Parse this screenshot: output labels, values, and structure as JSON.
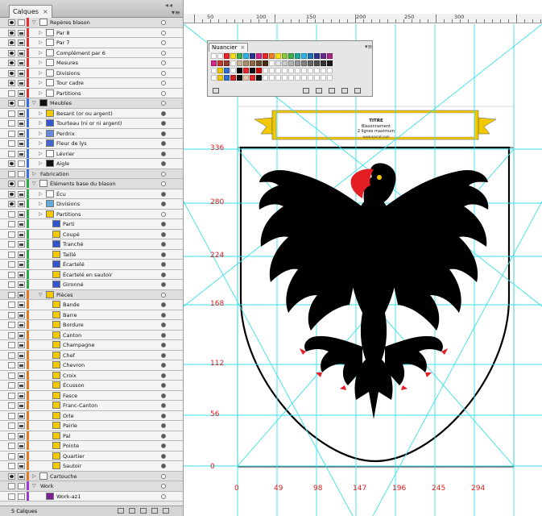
{
  "layers_panel": {
    "tab_label": "Calques",
    "close_glyph": "×",
    "grip": "◂◂",
    "menu_glyph": "▾≡",
    "footer_count": "5 Calques",
    "rows": [
      {
        "label": "Repères blason",
        "type": "layer",
        "depth": 0,
        "eye": true,
        "lock": false,
        "color": "#e03030",
        "expanded": true,
        "thumb": "#ffffff",
        "target": "hollow"
      },
      {
        "label": "Par 8",
        "type": "item",
        "depth": 1,
        "eye": true,
        "lock": true,
        "color": "#e03030",
        "thumb": "#ffffff",
        "target": "hollow"
      },
      {
        "label": "Par 7",
        "type": "item",
        "depth": 1,
        "eye": true,
        "lock": true,
        "color": "#e03030",
        "thumb": "#ffffff",
        "target": "hollow"
      },
      {
        "label": "Complément par 6",
        "type": "item",
        "depth": 1,
        "eye": true,
        "lock": true,
        "color": "#e03030",
        "thumb": "#ffffff",
        "target": "hollow"
      },
      {
        "label": "Mesures",
        "type": "item",
        "depth": 1,
        "eye": true,
        "lock": true,
        "color": "#e03030",
        "thumb": "#ffffff",
        "target": "hollow"
      },
      {
        "label": "Divisions",
        "type": "item",
        "depth": 1,
        "eye": true,
        "lock": true,
        "color": "#e03030",
        "thumb": "#ffffff",
        "target": "hollow"
      },
      {
        "label": "Tour cadre",
        "type": "item",
        "depth": 1,
        "eye": true,
        "lock": true,
        "color": "#e03030",
        "thumb": "#ffffff",
        "target": "hollow"
      },
      {
        "label": "Partitions",
        "type": "item",
        "depth": 1,
        "eye": false,
        "lock": true,
        "color": "#e03030",
        "thumb": "#ffffff",
        "target": "hollow"
      },
      {
        "label": "Meubles",
        "type": "layer",
        "depth": 0,
        "eye": true,
        "lock": false,
        "color": "#3a6ee0",
        "expanded": true,
        "thumb": "#111111",
        "target": "hollow"
      },
      {
        "label": "Besant (or ou argent)",
        "type": "item",
        "depth": 1,
        "eye": false,
        "lock": true,
        "color": "#3a6ee0",
        "thumb": "#f2c800",
        "target": "filled"
      },
      {
        "label": "Tourteau (ni or ni argent)",
        "type": "item",
        "depth": 1,
        "eye": false,
        "lock": true,
        "color": "#3a6ee0",
        "thumb": "#3355cc",
        "target": "filled"
      },
      {
        "label": "Perdrix",
        "type": "item",
        "depth": 1,
        "eye": false,
        "lock": true,
        "color": "#3a6ee0",
        "thumb": "#6688dd",
        "target": "filled"
      },
      {
        "label": "Fleur de lys",
        "type": "item",
        "depth": 1,
        "eye": false,
        "lock": true,
        "color": "#3a6ee0",
        "thumb": "#4466cc",
        "target": "filled"
      },
      {
        "label": "Lévrier",
        "type": "item",
        "depth": 1,
        "eye": false,
        "lock": true,
        "color": "#3a6ee0",
        "thumb": "#ffffff",
        "target": "filled"
      },
      {
        "label": "Aigle",
        "type": "item",
        "depth": 1,
        "eye": true,
        "lock": false,
        "color": "#3a6ee0",
        "thumb": "#111111",
        "target": "filled"
      },
      {
        "label": "Fabrication",
        "type": "layer",
        "depth": 0,
        "eye": false,
        "lock": false,
        "color": "#3a6ee0",
        "expanded": false,
        "thumb": "",
        "target": "hollow"
      },
      {
        "label": "Éléments base du blason",
        "type": "layer",
        "depth": 0,
        "eye": true,
        "lock": false,
        "color": "#2aa84a",
        "expanded": true,
        "thumb": "#ffffff",
        "target": "hollow"
      },
      {
        "label": "Écu",
        "type": "item",
        "depth": 1,
        "eye": true,
        "lock": true,
        "color": "#2aa84a",
        "thumb": "#ffffff",
        "target": "filled"
      },
      {
        "label": "Divisions",
        "type": "item",
        "depth": 1,
        "eye": true,
        "lock": true,
        "color": "#2aa84a",
        "thumb": "#66aadd",
        "target": "filled"
      },
      {
        "label": "Partitions",
        "type": "item",
        "depth": 1,
        "eye": false,
        "lock": true,
        "color": "#2aa84a",
        "thumb": "#f2c800",
        "target": "hollow"
      },
      {
        "label": "Parti",
        "type": "item",
        "depth": 2,
        "eye": false,
        "lock": true,
        "color": "#2aa84a",
        "thumb": "#3355cc",
        "target": "filled"
      },
      {
        "label": "Coupé",
        "type": "item",
        "depth": 2,
        "eye": false,
        "lock": true,
        "color": "#2aa84a",
        "thumb": "#f2c800",
        "target": "filled"
      },
      {
        "label": "Tranché",
        "type": "item",
        "depth": 2,
        "eye": false,
        "lock": true,
        "color": "#2aa84a",
        "thumb": "#3355cc",
        "target": "filled"
      },
      {
        "label": "Taillé",
        "type": "item",
        "depth": 2,
        "eye": false,
        "lock": true,
        "color": "#2aa84a",
        "thumb": "#f2c800",
        "target": "filled"
      },
      {
        "label": "Écartelé",
        "type": "item",
        "depth": 2,
        "eye": false,
        "lock": true,
        "color": "#2aa84a",
        "thumb": "#3355cc",
        "target": "filled"
      },
      {
        "label": "Écartelé en sautoir",
        "type": "item",
        "depth": 2,
        "eye": false,
        "lock": true,
        "color": "#2aa84a",
        "thumb": "#f2c800",
        "target": "filled"
      },
      {
        "label": "Gironné",
        "type": "item",
        "depth": 2,
        "eye": false,
        "lock": true,
        "color": "#2aa84a",
        "thumb": "#3355cc",
        "target": "filled"
      },
      {
        "label": "Pièces",
        "type": "layer",
        "depth": 1,
        "eye": false,
        "lock": true,
        "color": "#e07a20",
        "expanded": true,
        "thumb": "#f2c800",
        "target": "hollow"
      },
      {
        "label": "Bande",
        "type": "item",
        "depth": 2,
        "eye": false,
        "lock": true,
        "color": "#e07a20",
        "thumb": "#f2c800",
        "target": "filled"
      },
      {
        "label": "Barre",
        "type": "item",
        "depth": 2,
        "eye": false,
        "lock": true,
        "color": "#e07a20",
        "thumb": "#f2c800",
        "target": "filled"
      },
      {
        "label": "Bordure",
        "type": "item",
        "depth": 2,
        "eye": false,
        "lock": true,
        "color": "#e07a20",
        "thumb": "#f2c800",
        "target": "filled"
      },
      {
        "label": "Canton",
        "type": "item",
        "depth": 2,
        "eye": false,
        "lock": true,
        "color": "#e07a20",
        "thumb": "#f2c800",
        "target": "filled"
      },
      {
        "label": "Champagne",
        "type": "item",
        "depth": 2,
        "eye": false,
        "lock": true,
        "color": "#e07a20",
        "thumb": "#f2c800",
        "target": "filled"
      },
      {
        "label": "Chef",
        "type": "item",
        "depth": 2,
        "eye": false,
        "lock": true,
        "color": "#e07a20",
        "thumb": "#f2c800",
        "target": "filled"
      },
      {
        "label": "Chevron",
        "type": "item",
        "depth": 2,
        "eye": false,
        "lock": true,
        "color": "#e07a20",
        "thumb": "#f2c800",
        "target": "filled"
      },
      {
        "label": "Croix",
        "type": "item",
        "depth": 2,
        "eye": false,
        "lock": true,
        "color": "#e07a20",
        "thumb": "#f2c800",
        "target": "filled"
      },
      {
        "label": "Écusson",
        "type": "item",
        "depth": 2,
        "eye": false,
        "lock": true,
        "color": "#e07a20",
        "thumb": "#f2c800",
        "target": "filled"
      },
      {
        "label": "Fasce",
        "type": "item",
        "depth": 2,
        "eye": false,
        "lock": true,
        "color": "#e07a20",
        "thumb": "#f2c800",
        "target": "filled"
      },
      {
        "label": "Franc-Canton",
        "type": "item",
        "depth": 2,
        "eye": false,
        "lock": true,
        "color": "#e07a20",
        "thumb": "#f2c800",
        "target": "filled"
      },
      {
        "label": "Orle",
        "type": "item",
        "depth": 2,
        "eye": false,
        "lock": true,
        "color": "#e07a20",
        "thumb": "#f2c800",
        "target": "filled"
      },
      {
        "label": "Pairle",
        "type": "item",
        "depth": 2,
        "eye": false,
        "lock": true,
        "color": "#e07a20",
        "thumb": "#f2c800",
        "target": "filled"
      },
      {
        "label": "Pal",
        "type": "item",
        "depth": 2,
        "eye": false,
        "lock": true,
        "color": "#e07a20",
        "thumb": "#f2c800",
        "target": "filled"
      },
      {
        "label": "Pointe",
        "type": "item",
        "depth": 2,
        "eye": false,
        "lock": true,
        "color": "#e07a20",
        "thumb": "#f2c800",
        "target": "filled"
      },
      {
        "label": "Quartier",
        "type": "item",
        "depth": 2,
        "eye": false,
        "lock": true,
        "color": "#e07a20",
        "thumb": "#f2c800",
        "target": "filled"
      },
      {
        "label": "Sautoir",
        "type": "item",
        "depth": 2,
        "eye": false,
        "lock": true,
        "color": "#e07a20",
        "thumb": "#f2c800",
        "target": "filled"
      },
      {
        "label": "Cartouche",
        "type": "layer",
        "depth": 0,
        "eye": true,
        "lock": true,
        "color": "#e07a20",
        "expanded": false,
        "thumb": "#ffffff",
        "target": "hollow"
      },
      {
        "label": "Work",
        "type": "layer",
        "depth": 0,
        "eye": false,
        "lock": false,
        "color": "#9a3ad0",
        "expanded": true,
        "thumb": "",
        "target": "hollow"
      },
      {
        "label": "Work-az1",
        "type": "item",
        "depth": 1,
        "eye": false,
        "lock": false,
        "color": "#9a3ad0",
        "thumb": "#7a2090",
        "target": "hollow"
      }
    ]
  },
  "swatches_panel": {
    "tab_label": "Nuancier",
    "close_glyph": "×",
    "menu_glyph": "▾≡",
    "colors_row1": [
      "#ffffff",
      "#ffffff",
      "#e8262a",
      "#f9e11a",
      "#3dae49",
      "#2fb3e6",
      "#2d3192",
      "#d3268b",
      "#e8262a",
      "#f07e26",
      "#f9e11a",
      "#8dc63f",
      "#3dae49",
      "#1fa89a",
      "#2fb3e6",
      "#1f6fb6",
      "#2d3192",
      "#6a2c8f",
      "#a72a86"
    ],
    "colors_row2": [
      "#d3268b",
      "#c0392b",
      "#9b3a2a",
      "#ffffff",
      "#c8b49a",
      "#a88e6a",
      "#8a6a46",
      "#6a4a2a",
      "#4a2f16",
      "#ffffff",
      "#e6e6e6",
      "#cccccc",
      "#b3b3b3",
      "#999999",
      "#808080",
      "#666666",
      "#4d4d4d",
      "#333333",
      "#1a1a1a"
    ],
    "colors_row3": [
      "#ffffff",
      "#f2c800",
      "#2f6fd0",
      "#ffffff",
      "#000000",
      "#e8262a",
      "#111111",
      "#cc0000",
      "#ffffff",
      "#ffffff",
      "#ffffff",
      "#ffffff",
      "#ffffff",
      "#ffffff",
      "#ffffff",
      "#ffffff",
      "#ffffff",
      "#ffffff",
      "#ffffff"
    ],
    "colors_row4": [
      "#ffffff",
      "#f2c800",
      "#2f6fd0",
      "#cc2222",
      "#111111",
      "#e6c8b0",
      "#e8262a",
      "#111111",
      "#ffffff",
      "#ffffff",
      "#ffffff",
      "#ffffff",
      "#ffffff",
      "#ffffff",
      "#ffffff",
      "#ffffff",
      "#ffffff",
      "#ffffff",
      "#ffffff"
    ]
  },
  "ruler": {
    "labels": [
      "50",
      "100",
      "150",
      "200",
      "250",
      "300"
    ]
  },
  "measures": {
    "y_labels": [
      "336",
      "280",
      "224",
      "168",
      "112",
      "56",
      "0"
    ],
    "x_labels": [
      "0",
      "49",
      "98",
      "147",
      "196",
      "245",
      "294"
    ]
  },
  "cartouche": {
    "title": "TITRE",
    "line1": "Blasonnement",
    "line2": "2 lignes maximum",
    "url": "www.ancrat.com"
  },
  "colors": {
    "guide": "#38e0e8",
    "measure": "#d82020",
    "gold": "#f2c800",
    "eagle": "#000000",
    "beak": "#e31e24"
  }
}
